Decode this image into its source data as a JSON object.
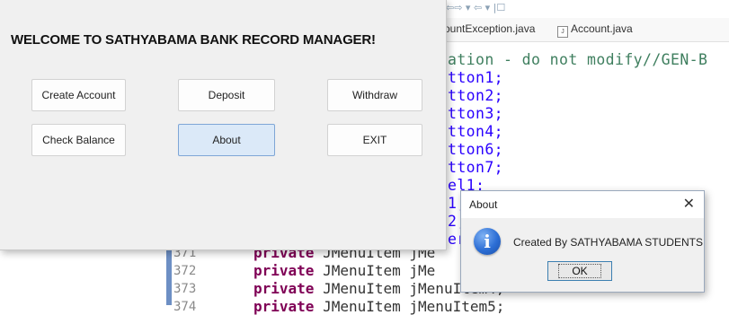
{
  "ide": {
    "tabs": [
      {
        "label": "ountException.java"
      },
      {
        "label": "Account.java"
      }
    ],
    "code_fragments": [
      "ation - do not modify//GEN-B",
      "tton1;",
      "tton2;",
      "tton3;",
      "tton4;",
      "tton6;",
      "tton7;",
      "el1;",
      "1;",
      "2;",
      "er"
    ],
    "lines": [
      {
        "number": "371",
        "keyword": "private",
        "rest": "JMenuItem jMe"
      },
      {
        "number": "372",
        "keyword": "private",
        "rest": "JMenuItem jMe"
      },
      {
        "number": "373",
        "keyword": "private",
        "rest": "JMenuItem jMenuItem4;"
      },
      {
        "number": "374",
        "keyword": "private",
        "rest": "JMenuItem jMenuItem5;"
      }
    ]
  },
  "main_window": {
    "welcome_text": "WELCOME TO SATHYABAMA BANK RECORD MANAGER!",
    "buttons": {
      "create_account": "Create Account",
      "deposit": "Deposit",
      "withdraw": "Withdraw",
      "check_balance": "Check Balance",
      "about": "About",
      "exit": "EXIT"
    }
  },
  "about_dialog": {
    "title": "About",
    "close_glyph": "✕",
    "icon_glyph": "i",
    "message": "Created By SATHYABAMA STUDENTS",
    "ok_label": "OK"
  },
  "colors": {
    "keyword": "#7f0055",
    "string": "#2a00ff",
    "focused_button": "#dbe9f8",
    "info_icon": "#2c6ed5"
  }
}
